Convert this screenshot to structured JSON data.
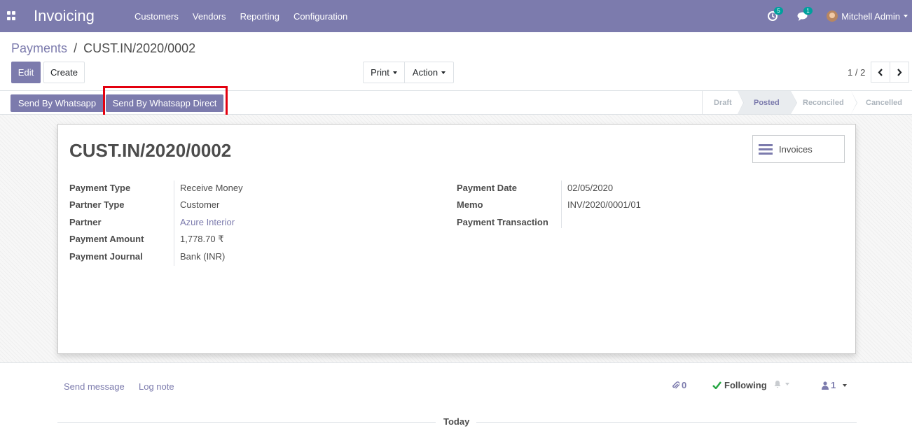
{
  "navbar": {
    "app_name": "Invoicing",
    "menu": [
      "Customers",
      "Vendors",
      "Reporting",
      "Configuration"
    ],
    "activity_count": "5",
    "messages_count": "1",
    "user_name": "Mitchell Admin",
    "color": "#7c7bad"
  },
  "breadcrumb": {
    "parent": "Payments",
    "separator": "/",
    "current": "CUST.IN/2020/0002"
  },
  "buttons": {
    "edit": "Edit",
    "create": "Create",
    "print": "Print",
    "action": "Action"
  },
  "pager": {
    "value": "1 / 2"
  },
  "statusbar": {
    "send_whatsapp": "Send By Whatsapp",
    "send_whatsapp_direct": "Send By Whatsapp Direct",
    "stages": [
      "Draft",
      "Posted",
      "Reconciled",
      "Cancelled"
    ],
    "active_stage": "Posted"
  },
  "record": {
    "title": "CUST.IN/2020/0002",
    "smart_button": "Invoices",
    "left_fields": [
      {
        "label": "Payment Type",
        "value": "Receive Money"
      },
      {
        "label": "Partner Type",
        "value": "Customer"
      },
      {
        "label": "Partner",
        "value": "Azure Interior"
      },
      {
        "label": "Payment Amount",
        "value": "1,778.70 ₹"
      },
      {
        "label": "Payment Journal",
        "value": "Bank (INR)"
      }
    ],
    "right_fields": [
      {
        "label": "Payment Date",
        "value": "02/05/2020"
      },
      {
        "label": "Memo",
        "value": "INV/2020/0001/01"
      },
      {
        "label": "Payment Transaction",
        "value": ""
      }
    ]
  },
  "chatter": {
    "send_message": "Send message",
    "log_note": "Log note",
    "attachments": "0",
    "following": "Following",
    "followers": "1",
    "today": "Today"
  }
}
